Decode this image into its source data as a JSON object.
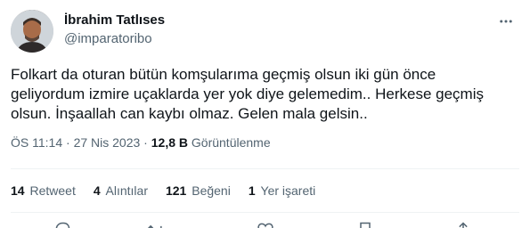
{
  "author": {
    "display_name": "İbrahim Tatlıses",
    "handle": "@imparatoribo"
  },
  "tweet": {
    "text": "Folkart da oturan bütün komşularıma geçmiş olsun iki gün önce\ngeliyordum izmire uçaklarda yer yok diye gelemedim.. Herkese geçmiş\nolsun. İnşaallah can kaybı olmaz. Gelen mala gelsin.."
  },
  "meta": {
    "time": "ÖS 11:14",
    "separator": " · ",
    "date": "27 Nis 2023",
    "views_count": "12,8 B",
    "views_label": "Görüntülenme"
  },
  "stats": {
    "retweets_count": "14",
    "retweets_label": "Retweet",
    "quotes_count": "4",
    "quotes_label": "Alıntılar",
    "likes_count": "121",
    "likes_label": "Beğeni",
    "bookmarks_count": "1",
    "bookmarks_label": "Yer işareti"
  },
  "icons": {
    "more": "more-horizontal-icon",
    "reply": "reply-icon",
    "retweet": "retweet-icon",
    "like": "heart-icon",
    "bookmark": "bookmark-icon",
    "share": "share-icon"
  },
  "colors": {
    "text_primary": "#0f1419",
    "text_secondary": "#536471",
    "divider": "#eff3f4"
  }
}
